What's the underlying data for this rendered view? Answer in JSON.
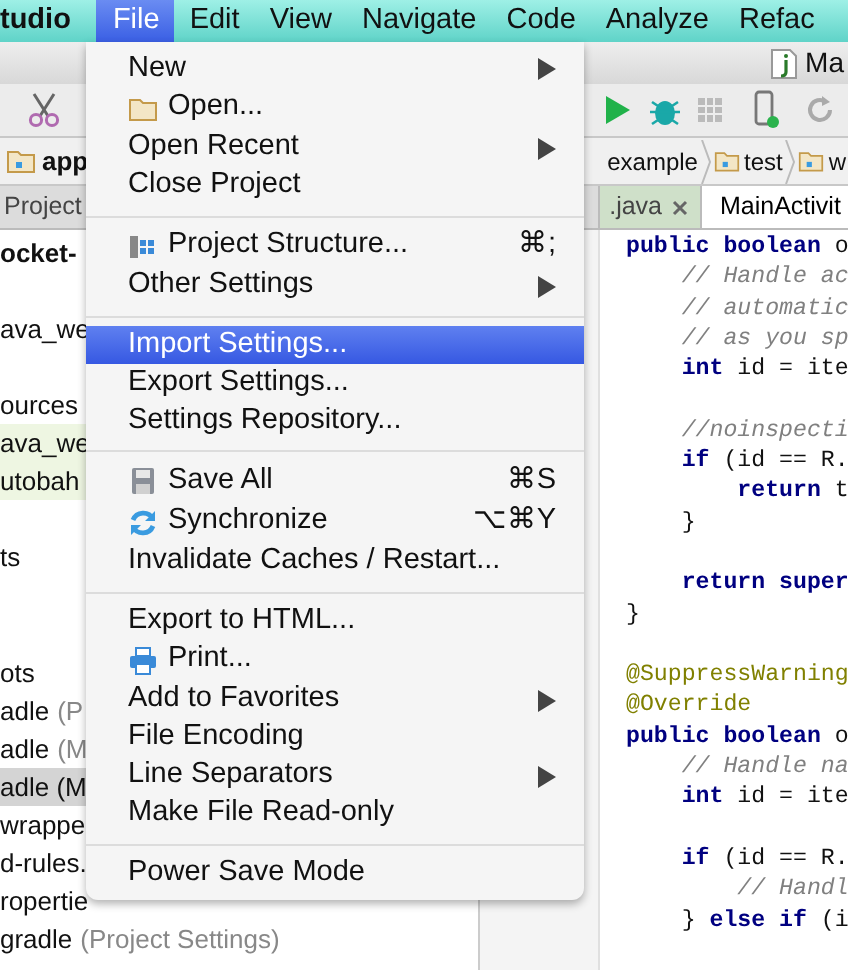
{
  "menu_bar": [
    {
      "label": "tudio",
      "kind": "app",
      "selected": false
    },
    {
      "label": "File",
      "kind": "menu",
      "selected": true
    },
    {
      "label": "Edit",
      "kind": "menu",
      "selected": false
    },
    {
      "label": "View",
      "kind": "menu",
      "selected": false
    },
    {
      "label": "Navigate",
      "kind": "menu",
      "selected": false
    },
    {
      "label": "Code",
      "kind": "menu",
      "selected": false
    },
    {
      "label": "Analyze",
      "kind": "menu",
      "selected": false
    },
    {
      "label": "Refac",
      "kind": "menu",
      "selected": false
    }
  ],
  "title_bar": {
    "file_tab": "Ma"
  },
  "navigation_bar": {
    "root": "app",
    "path": [
      "example",
      "test",
      "w"
    ]
  },
  "editor_tabs": [
    {
      "label": "Project",
      "kind": "tool",
      "selected": false
    },
    {
      "label": ".java",
      "kind": "file",
      "selected": false
    },
    {
      "label": "MainActivit",
      "kind": "file",
      "selected": true
    }
  ],
  "project_tree": [
    {
      "label": "ocket-",
      "bold": true,
      "selected": false
    },
    {
      "label": "ava_we",
      "selected": false,
      "gap_before": true
    },
    {
      "label": "ources",
      "selected": false,
      "gap_before": true
    },
    {
      "label": "ava_we",
      "selected": false,
      "tinted": true
    },
    {
      "label": "utobah",
      "selected": false,
      "tinted": true
    },
    {
      "label": "ts",
      "selected": false,
      "gap_before": true
    },
    {
      "label": "ots",
      "selected": false,
      "gap_before": true,
      "gap_large": true
    },
    {
      "label": "adle",
      "note": "(P",
      "selected": false
    },
    {
      "label": "adle",
      "note": "(M",
      "selected": false
    },
    {
      "label": "adle (M",
      "selected": true
    },
    {
      "label": "wrappe",
      "selected": false
    },
    {
      "label": "d-rules.",
      "selected": false
    },
    {
      "label": "ropertie",
      "selected": false
    },
    {
      "label": "gradle",
      "note": "(Project Settings)",
      "selected": false
    }
  ],
  "code": [
    {
      "kind": "code",
      "text": "**public boolean** o"
    },
    {
      "kind": "comment",
      "text": "    // Handle ac"
    },
    {
      "kind": "comment",
      "text": "    // automatic"
    },
    {
      "kind": "comment",
      "text": "    // as you sp"
    },
    {
      "kind": "code",
      "text": "    **int** id = ite"
    },
    {
      "kind": "comment",
      "blank_before": true,
      "text": "    //noinspecti"
    },
    {
      "kind": "code",
      "text": "    **if** (id == R."
    },
    {
      "kind": "code",
      "text": "        **return** t"
    },
    {
      "kind": "code",
      "text": "    }"
    },
    {
      "kind": "code",
      "blank_before": true,
      "text": "    **return super**"
    },
    {
      "kind": "code",
      "text": "}"
    },
    {
      "kind": "annotation",
      "blank_before": true,
      "text": "@SuppressWarning"
    },
    {
      "kind": "annotation",
      "text": "@Override"
    },
    {
      "kind": "code",
      "text": "**public boolean** o"
    },
    {
      "kind": "comment",
      "text": "    // Handle na"
    },
    {
      "kind": "code",
      "text": "    **int** id = ite"
    },
    {
      "kind": "code",
      "blank_before": true,
      "text": "    **if** (id == R."
    },
    {
      "kind": "comment",
      "text": "        // Handl"
    },
    {
      "kind": "code",
      "text": "    } **else if** (i"
    }
  ],
  "file_menu": [
    [
      {
        "label": "New",
        "kind": "plain",
        "submenu": true,
        "selected": false
      },
      {
        "label": "Open...",
        "kind": "folder",
        "selected": false
      },
      {
        "label": "Open Recent",
        "kind": "plain",
        "submenu": true,
        "selected": false
      },
      {
        "label": "Close Project",
        "kind": "plain",
        "selected": false
      }
    ],
    [
      {
        "label": "Project Structure...",
        "kind": "structure",
        "shortcut": "⌘;",
        "selected": false
      },
      {
        "label": "Other Settings",
        "kind": "plain",
        "submenu": true,
        "selected": false
      }
    ],
    [
      {
        "label": "Import Settings...",
        "kind": "plain",
        "selected": true
      },
      {
        "label": "Export Settings...",
        "kind": "plain",
        "selected": false
      },
      {
        "label": "Settings Repository...",
        "kind": "plain",
        "selected": false
      }
    ],
    [
      {
        "label": "Save All",
        "kind": "save",
        "shortcut": "⌘S",
        "selected": false
      },
      {
        "label": "Synchronize",
        "kind": "sync",
        "shortcut": "⌥⌘Y",
        "selected": false
      },
      {
        "label": "Invalidate Caches / Restart...",
        "kind": "plain",
        "selected": false
      }
    ],
    [
      {
        "label": "Export to HTML...",
        "kind": "plain",
        "selected": false
      },
      {
        "label": "Print...",
        "kind": "print",
        "selected": false
      },
      {
        "label": "Add to Favorites",
        "kind": "plain",
        "submenu": true,
        "selected": false
      },
      {
        "label": "File Encoding",
        "kind": "plain",
        "selected": false
      },
      {
        "label": "Line Separators",
        "kind": "plain",
        "submenu": true,
        "selected": false
      },
      {
        "label": "Make File Read-only",
        "kind": "plain",
        "selected": false
      }
    ],
    [
      {
        "label": "Power Save Mode",
        "kind": "plain",
        "selected": false
      }
    ]
  ]
}
